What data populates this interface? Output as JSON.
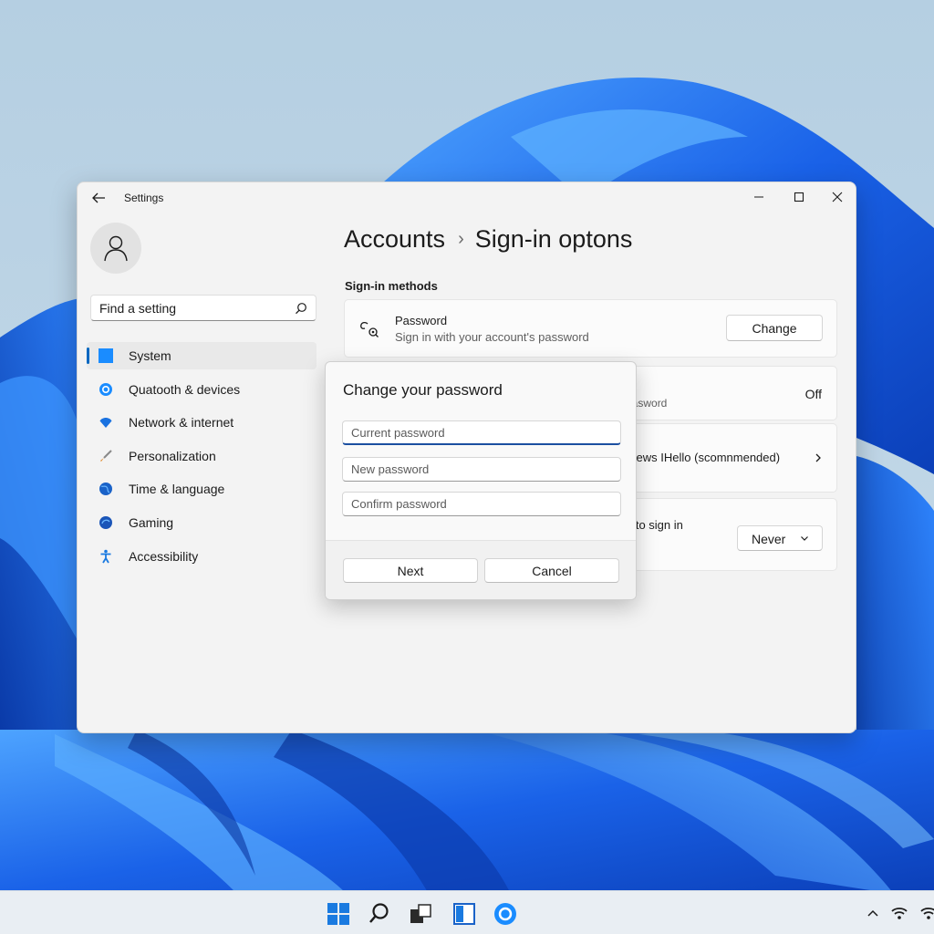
{
  "window": {
    "app_title": "Settings"
  },
  "search": {
    "placeholder": "Find a setting"
  },
  "sidebar": {
    "items": [
      {
        "label": "System",
        "icon": "system-icon",
        "selected": true
      },
      {
        "label": "Quatooth & devices",
        "icon": "bluetooth-icon"
      },
      {
        "label": "Network & internet",
        "icon": "network-icon"
      },
      {
        "label": "Personalization",
        "icon": "brush-icon"
      },
      {
        "label": "Time & language",
        "icon": "globe-icon"
      },
      {
        "label": "Gaming",
        "icon": "gaming-icon"
      },
      {
        "label": "Accessibility",
        "icon": "accessibility-icon"
      }
    ]
  },
  "header": {
    "parent": "Accounts",
    "separator": "›",
    "current": "Sign-in optons"
  },
  "main": {
    "section_title": "Sign-in methods",
    "password": {
      "title": "Password",
      "subtitle": "Sign in with your account's password",
      "button": "Change"
    },
    "row2": {
      "partial_text": "aasword",
      "value": "Off"
    },
    "row3": {
      "partial_text": "rdews IHello (scomnmended)"
    },
    "row4": {
      "partial_text": "e to sign in",
      "select_value": "Never"
    }
  },
  "dialog": {
    "title": "Change your password",
    "fields": {
      "current_placeholder": "Current password",
      "new_placeholder": "New password",
      "confirm_placeholder": "Confirm password"
    },
    "next_label": "Next",
    "cancel_label": "Cancel"
  },
  "colors": {
    "accent": "#0067c0",
    "wallpaper_blue": "#1a5fe0",
    "wallpaper_sky": "#b9d3e6"
  }
}
